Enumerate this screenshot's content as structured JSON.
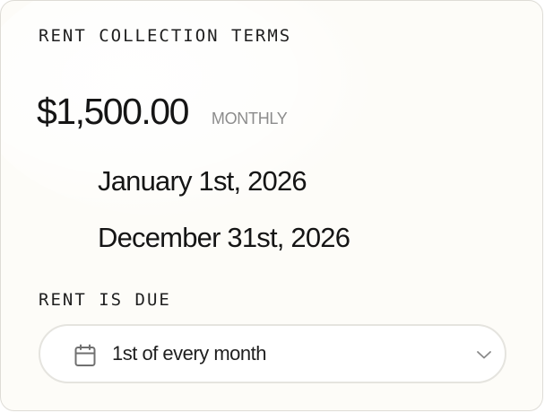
{
  "card": {
    "title": "RENT COLLECTION TERMS",
    "amount": "$1,500.00",
    "frequency": "MONTHLY",
    "start_date": "January 1st, 2026",
    "end_date": "December 31st, 2026",
    "due_label": "RENT IS DUE",
    "due_select": {
      "value": "1st of every month",
      "icon": "calendar-icon",
      "chevron": "chevron-down-icon"
    }
  },
  "colors": {
    "card_background": "#fdfcf8",
    "text_primary": "#151515",
    "text_muted": "#8c8c8c",
    "border": "#e5e4df"
  }
}
